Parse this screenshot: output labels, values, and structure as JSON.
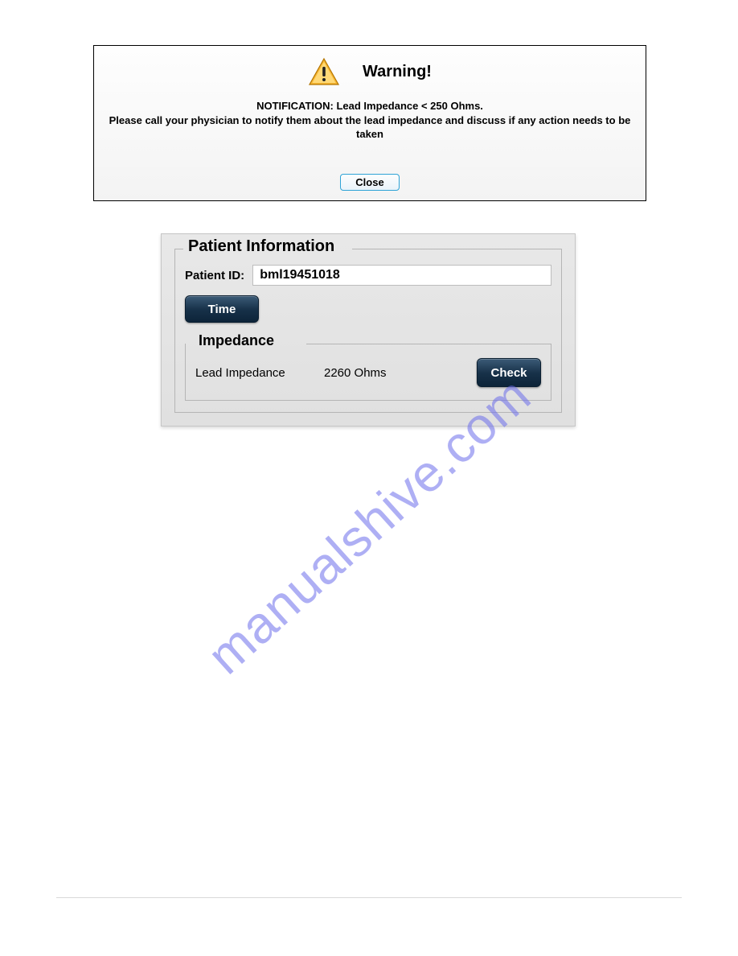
{
  "warning": {
    "title": "Warning!",
    "notification_line": "NOTIFICATION: Lead Impedance < 250 Ohms.",
    "instruction_line": "Please call your physician to notify them about the lead impedance and discuss if any action needs to be taken",
    "close_label": "Close"
  },
  "patient_info": {
    "fieldset_title": "Patient Information",
    "id_label": "Patient ID:",
    "id_value": "bml19451018",
    "time_button": "Time",
    "impedance": {
      "fieldset_title": "Impedance",
      "label": "Lead Impedance",
      "value": "2260 Ohms",
      "check_button": "Check"
    }
  },
  "watermark": "manualshive.com"
}
